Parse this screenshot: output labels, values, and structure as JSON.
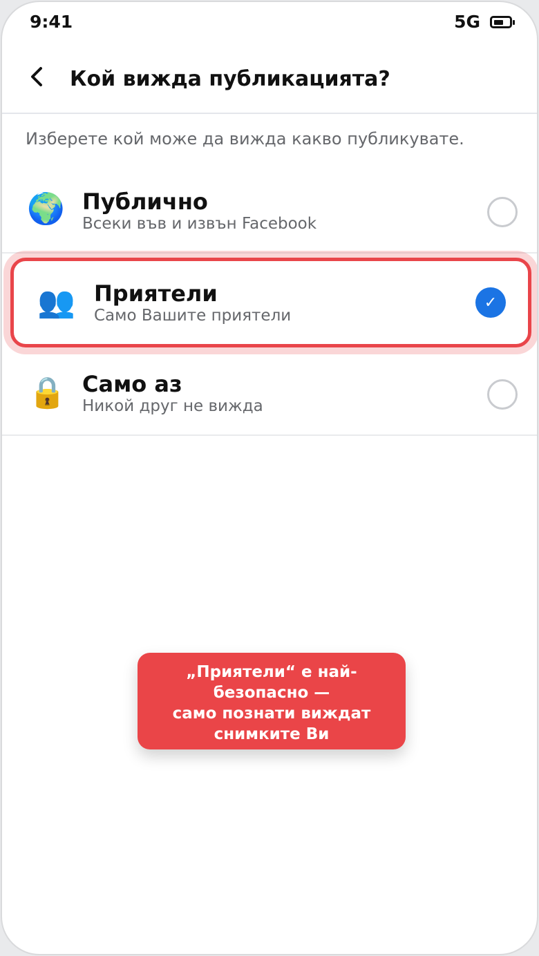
{
  "status_bar": {
    "time": "9:41",
    "network": "5G",
    "icons": [
      "battery-icon"
    ]
  },
  "header": {
    "title": "Кой вижда публикацията?",
    "back_icon": "chevron-left-icon"
  },
  "intro": "Изберете кой може да вижда какво публикувате.",
  "options": [
    {
      "icon": "🌍",
      "icon_name": "globe-icon",
      "title": "Публично",
      "subtitle": "Всеки във и извън Facebook",
      "selected": false
    },
    {
      "icon": "👥",
      "icon_name": "friends-icon",
      "title": "Приятели",
      "subtitle": "Само Вашите приятели",
      "selected": true
    },
    {
      "icon": "🔒",
      "icon_name": "lock-icon",
      "title": "Само аз",
      "subtitle": "Никой друг не вижда",
      "selected": false
    }
  ],
  "check_glyph": "✓",
  "tooltip": {
    "lines": [
      "„Приятели“ е най-",
      "безопасно —",
      "само познати виждат",
      "снимките Ви"
    ]
  },
  "colors": {
    "accent": "#1b74e4",
    "highlight": "#e9454a",
    "secondary_text": "#65676b"
  }
}
